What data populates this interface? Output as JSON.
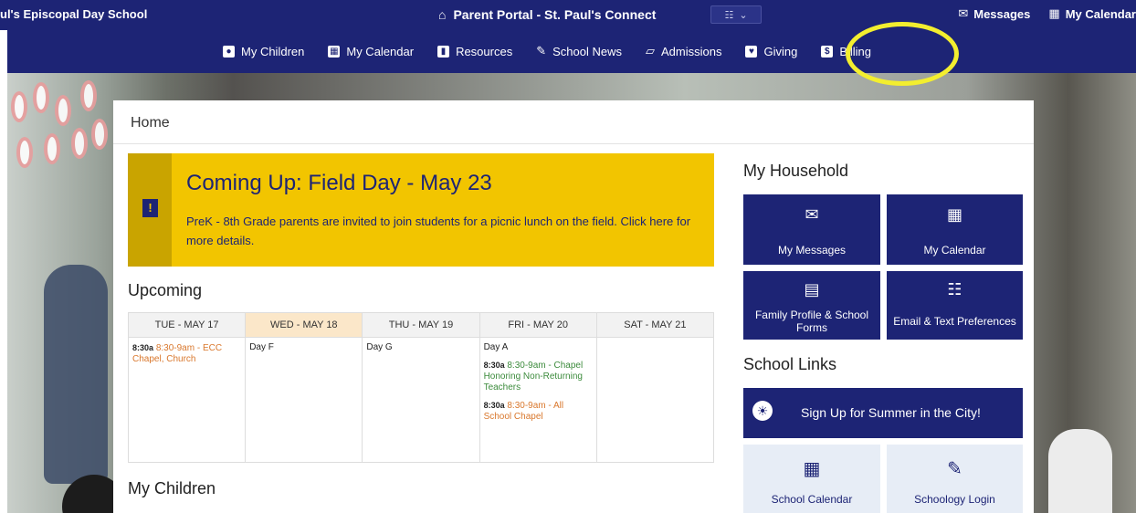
{
  "topbar": {
    "school_name": "ul's Episcopal Day School",
    "portal_title": "Parent Portal - St. Paul's Connect",
    "right_items": [
      "Messages",
      "My Calendar"
    ]
  },
  "nav": {
    "items": [
      {
        "label": "My Children",
        "icon": "person-icon"
      },
      {
        "label": "My Calendar",
        "icon": "calendar-icon"
      },
      {
        "label": "Resources",
        "icon": "book-icon"
      },
      {
        "label": "School News",
        "icon": "pencil-icon"
      },
      {
        "label": "Admissions",
        "icon": "image-icon"
      },
      {
        "label": "Giving",
        "icon": "heart-icon"
      },
      {
        "label": "Billing",
        "icon": "dollar-icon"
      }
    ]
  },
  "page": {
    "breadcrumb": "Home"
  },
  "alert": {
    "title": "Coming Up: Field Day - May 23",
    "text": "PreK - 8th Grade parents are invited to join students for a picnic lunch on the field. Click here for more details.",
    "badge": "!"
  },
  "upcoming": {
    "heading": "Upcoming",
    "days": [
      "TUE - MAY 17",
      "WED - MAY 18",
      "THU - MAY 19",
      "FRI - MAY 20",
      "SAT - MAY 21"
    ],
    "col_tue": {
      "time": "8:30a",
      "event": "8:30-9am - ECC Chapel, Church"
    },
    "col_wed": {
      "day": "Day F"
    },
    "col_thu": {
      "day": "Day G"
    },
    "col_fri": {
      "day": "Day A",
      "ev1_time": "8:30a",
      "ev1": "8:30-9am - Chapel Honoring Non-Returning Teachers",
      "ev2_time": "8:30a",
      "ev2": "8:30-9am - All School Chapel"
    }
  },
  "children": {
    "heading": "My Children"
  },
  "household": {
    "heading": "My Household",
    "tiles": [
      "My Messages",
      "My Calendar",
      "Family Profile & School Forms",
      "Email & Text Preferences"
    ]
  },
  "school_links": {
    "heading": "School Links",
    "banner": "Sign Up for Summer in the City!",
    "tiles": [
      "School Calendar",
      "Schoology Login"
    ]
  },
  "colors": {
    "navy": "#1d2475",
    "alert_yellow": "#f2c500",
    "highlight": "#f3ee2f"
  }
}
